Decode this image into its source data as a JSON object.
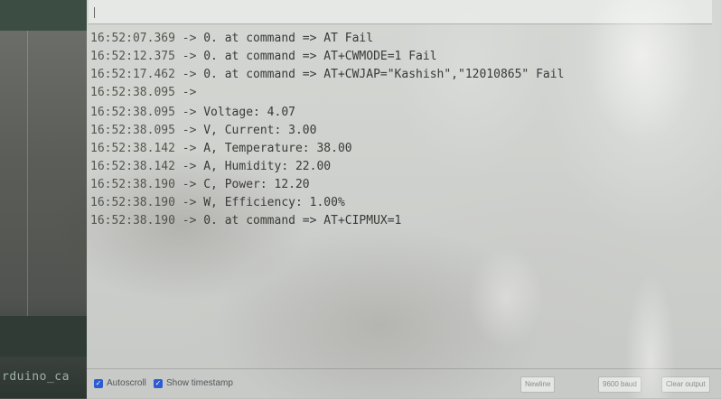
{
  "sketch": {
    "name_fragment": "rduino_ca"
  },
  "serial_monitor": {
    "input_value": "",
    "lines": [
      {
        "time": "16:52:07.369",
        "arrow": " -> ",
        "msg": "0. at command => AT Fail"
      },
      {
        "time": "16:52:12.375",
        "arrow": " -> ",
        "msg": "0. at command => AT+CWMODE=1 Fail"
      },
      {
        "time": "16:52:17.462",
        "arrow": " -> ",
        "msg": "0. at command => AT+CWJAP=\"Kashish\",\"12010865\" Fail"
      },
      {
        "time": "16:52:38.095",
        "arrow": " ->",
        "msg": ""
      },
      {
        "time": "16:52:38.095",
        "arrow": " -> ",
        "msg": "Voltage: 4.07"
      },
      {
        "time": "16:52:38.095",
        "arrow": " -> ",
        "msg": "V, Current: 3.00"
      },
      {
        "time": "16:52:38.142",
        "arrow": " -> ",
        "msg": "A, Temperature: 38.00"
      },
      {
        "time": "16:52:38.142",
        "arrow": " -> ",
        "msg": "A, Humidity: 22.00"
      },
      {
        "time": "16:52:38.190",
        "arrow": " -> ",
        "msg": "C, Power: 12.20"
      },
      {
        "time": "16:52:38.190",
        "arrow": " -> ",
        "msg": "W, Efficiency: 1.00%"
      },
      {
        "time": "16:52:38.190",
        "arrow": " -> ",
        "msg": "0. at command => AT+CIPMUX=1"
      }
    ]
  },
  "bottom_bar": {
    "autoscroll_label": "Autoscroll",
    "autoscroll_checked": true,
    "timestamp_label": "Show timestamp",
    "timestamp_checked": true,
    "line_ending": "Newline",
    "baud": "9600 baud",
    "clear_label": "Clear output"
  },
  "colors": {
    "checkbox_accent": "#2d5bd3"
  }
}
